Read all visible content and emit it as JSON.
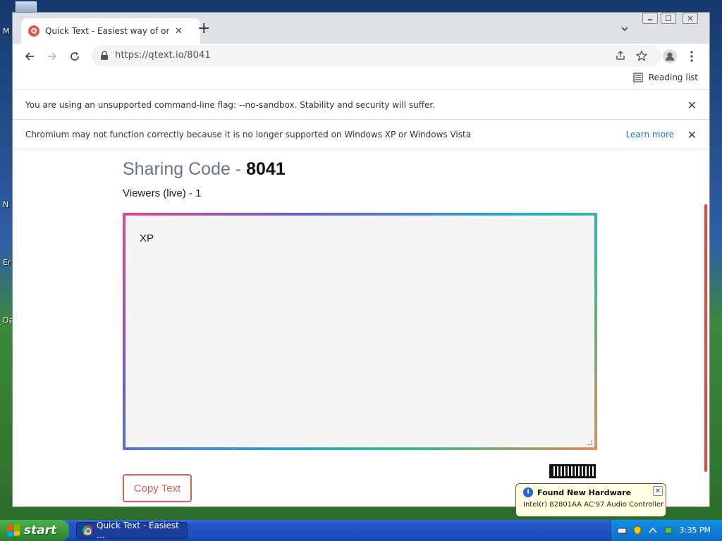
{
  "desktop": {
    "labels": [
      "M",
      "N",
      "Er",
      "Da"
    ]
  },
  "browser": {
    "tab_title": "Quick Text - Easiest way of online text sharing",
    "tab_favicon_letter": "Q",
    "tab_close": "✕",
    "new_tab": "+",
    "url": "https://qtext.io/8041",
    "reading_list": "Reading list",
    "infobar_sandbox": "You are using an unsupported command-line flag: --no-sandbox. Stability and security will suffer.",
    "infobar_xp": "Chromium may not function correctly because it is no longer supported on Windows XP or Windows Vista",
    "learn_more": "Learn more",
    "close_glyph": "✕"
  },
  "page": {
    "sharing_label": "Sharing Code - ",
    "sharing_code": "8041",
    "viewers": "Viewers (live) - 1",
    "editor_text": "XP",
    "copy_button": "Copy Text"
  },
  "balloon": {
    "title": "Found New Hardware",
    "text": "Intel(r) 82801AA AC'97 Audio Controller",
    "close": "✕"
  },
  "taskbar": {
    "start": "start",
    "task_item": "Quick Text - Easiest ...",
    "clock": "3:35 PM"
  },
  "colors": {
    "accent": "#e05d52",
    "link": "#1a73e8",
    "scrollbar": "#e24a3c"
  }
}
